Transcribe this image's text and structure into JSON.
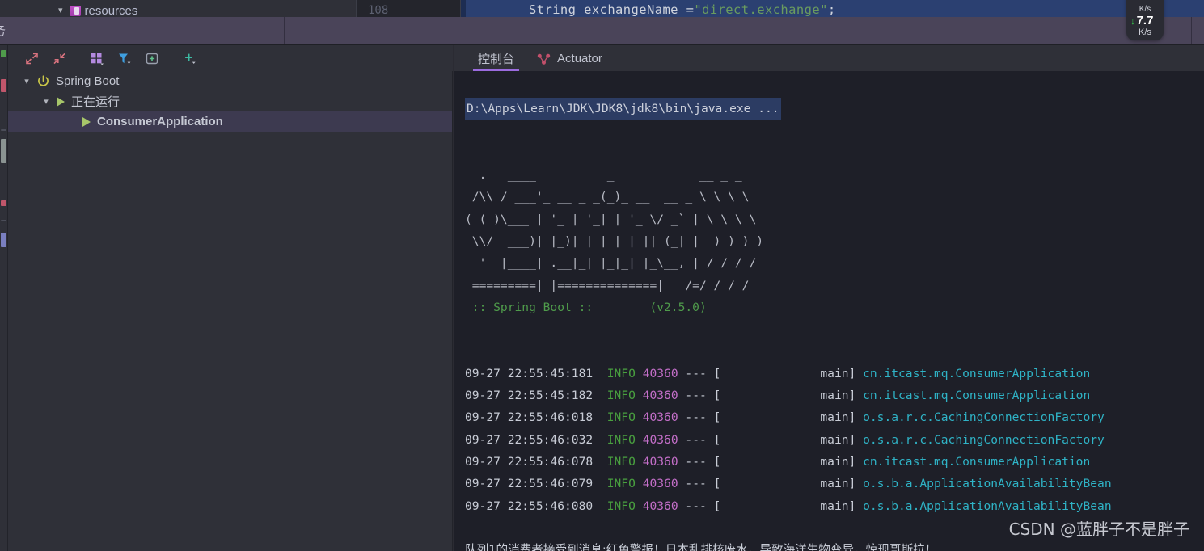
{
  "editor": {
    "tree_remnant_label": "resources",
    "gutter_line_number": "108",
    "code_keyword": "String exchangeName = ",
    "code_string": "\"direct.exchange\"",
    "code_punct": ";"
  },
  "breadcrumb": {
    "partial_text": "务"
  },
  "toolbar": {
    "items": [
      {
        "name": "expand-all-icon",
        "label": "Expand All"
      },
      {
        "name": "collapse-all-icon",
        "label": "Collapse All"
      },
      {
        "name": "group-by-icon",
        "label": "Group By"
      },
      {
        "name": "filter-icon",
        "label": "Filter"
      },
      {
        "name": "add-tab-icon",
        "label": "Add Tab"
      },
      {
        "name": "plus-icon",
        "label": "Add"
      }
    ]
  },
  "tree": {
    "root": {
      "label": "Spring Boot",
      "icon": "power-icon"
    },
    "group": {
      "label": "正在运行",
      "icon": "run-icon"
    },
    "item": {
      "label": "ConsumerApplication",
      "icon": "run-icon",
      "selected": true
    }
  },
  "console_tabs": [
    {
      "label": "控制台",
      "active": true,
      "icon": null
    },
    {
      "label": "Actuator",
      "active": false,
      "icon": "actuator-icon"
    }
  ],
  "console": {
    "command_line": "D:\\Apps\\Learn\\JDK\\JDK8\\jdk8\\bin\\java.exe ...",
    "banner_lines": [
      "  .   ____          _            __ _ _",
      " /\\\\ / ___'_ __ _ _(_)_ __  __ _ \\ \\ \\ \\",
      "( ( )\\___ | '_ | '_| | '_ \\/ _` | \\ \\ \\ \\",
      " \\\\/  ___)| |_)| | | | | || (_| |  ) ) ) )",
      "  '  |____| .__|_| |_|_| |_\\__, | / / / /",
      " =========|_|==============|___/=/_/_/_/"
    ],
    "banner_footer_left": " :: Spring Boot :: ",
    "banner_footer_right": "       (v2.5.0)",
    "log_lines": [
      {
        "ts": "09-27 22:55:45:181",
        "level": "INFO",
        "pid": "40360",
        "sep": "---",
        "thread": "main",
        "logger": "cn.itcast.mq.ConsumerApplication"
      },
      {
        "ts": "09-27 22:55:45:182",
        "level": "INFO",
        "pid": "40360",
        "sep": "---",
        "thread": "main",
        "logger": "cn.itcast.mq.ConsumerApplication"
      },
      {
        "ts": "09-27 22:55:46:018",
        "level": "INFO",
        "pid": "40360",
        "sep": "---",
        "thread": "main",
        "logger": "o.s.a.r.c.CachingConnectionFactory"
      },
      {
        "ts": "09-27 22:55:46:032",
        "level": "INFO",
        "pid": "40360",
        "sep": "---",
        "thread": "main",
        "logger": "o.s.a.r.c.CachingConnectionFactory"
      },
      {
        "ts": "09-27 22:55:46:078",
        "level": "INFO",
        "pid": "40360",
        "sep": "---",
        "thread": "main",
        "logger": "cn.itcast.mq.ConsumerApplication"
      },
      {
        "ts": "09-27 22:55:46:079",
        "level": "INFO",
        "pid": "40360",
        "sep": "---",
        "thread": "main",
        "logger": "o.s.b.a.ApplicationAvailabilityBean"
      },
      {
        "ts": "09-27 22:55:46:080",
        "level": "INFO",
        "pid": "40360",
        "sep": "---",
        "thread": "main",
        "logger": "o.s.b.a.ApplicationAvailabilityBean"
      }
    ],
    "app_message": "队列1的消费者接受到消息:红色警报！日本乱排核废水，导致海洋生物变异，惊现哥斯拉！"
  },
  "network_speed": {
    "top_unit": "K/s",
    "value": "7.7",
    "unit": "K/s",
    "direction_arrow": "↓"
  },
  "watermark": {
    "text": "CSDN @蓝胖子不是胖子"
  },
  "colors": {
    "console_bg": "#1e1f28",
    "panel_bg": "#2f3038",
    "accent_purple": "#9b6bdf",
    "selection": "#3d3a50",
    "log_level": "#49a03f",
    "log_pid": "#c46fc9",
    "log_logger": "#2fb3c6",
    "banner_green": "#4f9b4b",
    "code_string": "#6a9b5f",
    "net_arrow_green": "#35c44a"
  }
}
